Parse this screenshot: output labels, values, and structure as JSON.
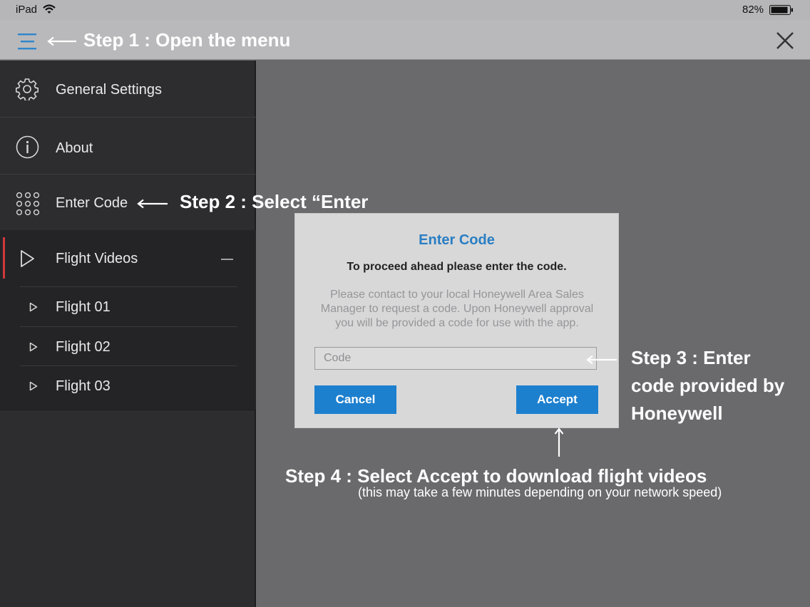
{
  "status_bar": {
    "device": "iPad",
    "battery": "82%"
  },
  "sidebar": {
    "items": [
      {
        "label": "General Settings",
        "icon": "gear-icon"
      },
      {
        "label": "About",
        "icon": "info-icon"
      },
      {
        "label": "Enter Code",
        "icon": "keypad-icon"
      },
      {
        "label": "Flight Videos",
        "icon": "play-icon"
      }
    ],
    "sub_items": [
      {
        "label": "Flight 01"
      },
      {
        "label": "Flight 02"
      },
      {
        "label": "Flight 03"
      }
    ]
  },
  "dialog": {
    "title": "Enter Code",
    "subtitle": "To proceed ahead please enter the code.",
    "body": "Please contact to your local Honeywell Area Sales Manager to request a code. Upon Honeywell approval you will be provided a code for use with the app.",
    "code_placeholder": "Code",
    "code_value": "",
    "cancel_label": "Cancel",
    "accept_label": "Accept"
  },
  "annotations": {
    "step1": "Step 1 : Open the menu",
    "step2": "Step 2 : Select “Enter",
    "step3_line1": "Step 3 : Enter",
    "step3_line2": "code provided by",
    "step3_line3": "Honeywell",
    "step4": "Step 4 : Select Accept to download flight videos",
    "step4_note": "(this may take a few minutes depending on your network speed)"
  },
  "colors": {
    "accent": "#1d80cf",
    "title": "#2a7ec3",
    "active_indicator": "#d0383b"
  }
}
